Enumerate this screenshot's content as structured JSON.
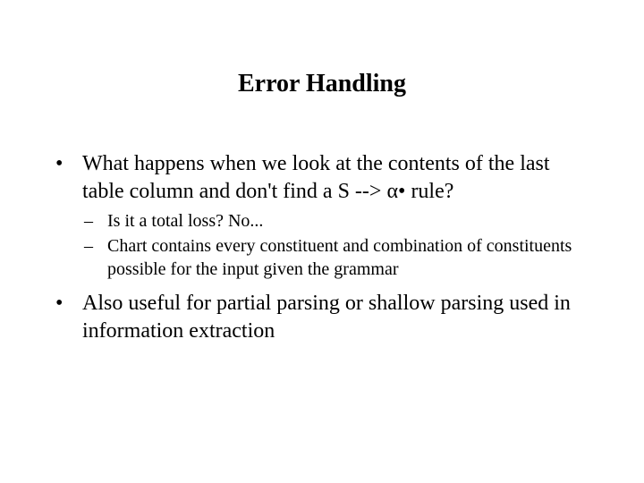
{
  "title": "Error Handling",
  "bullets": {
    "b1_part1": "What happens when we look at the contents of the last table column and don't find a S --> ",
    "b1_alpha": "α",
    "b1_dot": "•",
    "b1_part2": "  rule?",
    "b1_sub1": "Is it a total loss?  No...",
    "b1_sub2": "Chart contains every constituent and combination of constituents possible for the input given the grammar",
    "b2": "Also useful for partial parsing or shallow parsing used in information extraction"
  }
}
